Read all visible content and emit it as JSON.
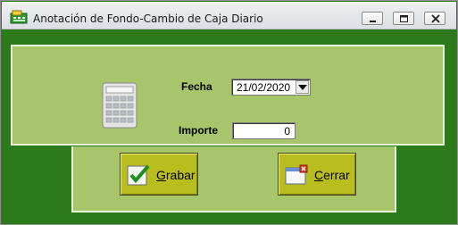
{
  "window": {
    "title": "Anotación de Fondo-Cambio de Caja Diario",
    "icons": {
      "app": "cash-register-icon",
      "minimize": "minimize-icon",
      "maximize": "maximize-icon",
      "close": "close-icon"
    }
  },
  "form": {
    "fecha_label": "Fecha",
    "fecha_value": "21/02/2020",
    "importe_label": "Importe",
    "importe_value": "0",
    "calculator_icon": "calculator-icon"
  },
  "buttons": {
    "grabar": {
      "accel": "G",
      "rest": "rabar",
      "icon": "checkmark-icon"
    },
    "cerrar": {
      "accel": "C",
      "rest": "errar",
      "icon": "close-window-icon"
    }
  },
  "colors": {
    "background": "#2c7a1c",
    "panel": "#a6c669",
    "button": "#b9bd1d"
  }
}
